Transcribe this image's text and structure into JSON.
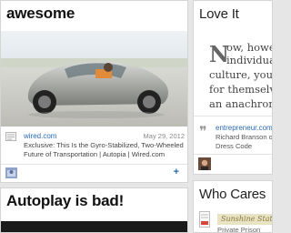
{
  "cards": {
    "awesome": {
      "title": "awesome",
      "source": "wired.com",
      "date": "May 29, 2012",
      "description": "Exclusive: This Is the Gyro-Stabilized, Two-Wheeled Future of Transportation | Autopia | Wired.com",
      "add_label": "+"
    },
    "autoplay": {
      "title": "Autoplay is bad!"
    },
    "loveit": {
      "title": "Love It",
      "dropcap": "N",
      "lines": [
        "ow, howeve",
        "individualiz",
        "culture, your a",
        "for themselves",
        "an anachronis"
      ],
      "source": "entrepreneur.com",
      "desc_line1": "Richard Branson o",
      "desc_line2": "Dress Code"
    },
    "whocares": {
      "title": "Who Cares",
      "thumb_text": "Sunshine State",
      "subtitle": "Private Prison"
    }
  },
  "colors": {
    "link": "#2a6bb3",
    "background": "#e6e6e6"
  }
}
